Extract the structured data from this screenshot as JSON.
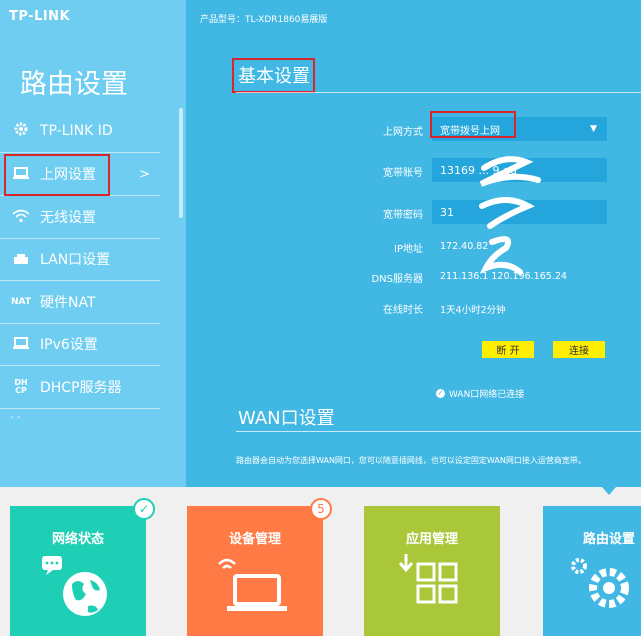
{
  "header": {
    "logo": "TP-LINK",
    "product_model": "产品型号：TL-XDR1860易展版"
  },
  "sidebar": {
    "title": "路由设置",
    "items": [
      {
        "label": "TP-LINK ID",
        "icon": "gear-icon"
      },
      {
        "label": "上网设置",
        "icon": "laptop-icon",
        "arrow": ">"
      },
      {
        "label": "无线设置",
        "icon": "wifi-icon"
      },
      {
        "label": "LAN口设置",
        "icon": "lan-icon"
      },
      {
        "label": "硬件NAT",
        "icon": "nat-icon",
        "icon_text": "NAT"
      },
      {
        "label": "IPv6设置",
        "icon": "laptop-icon"
      },
      {
        "label": "DHCP服务器",
        "icon": "dhcp-icon",
        "icon_text": "DH CP"
      }
    ],
    "more": "- -"
  },
  "basic": {
    "title": "基本设置",
    "connection_type_label": "上网方式",
    "connection_type_value": "宽带拨号上网",
    "account_label": "宽带账号",
    "account_value": "13169 ... 9.gd",
    "password_label": "宽带密码",
    "password_value": "31",
    "ip_label": "IP地址",
    "ip_value": "172.40.82",
    "dns_label": "DNS服务器",
    "dns_value": "211.136.1  120.196.165.24",
    "uptime_label": "在线时长",
    "uptime_value": "1天4小时2分钟",
    "disconnect_button": "断 开",
    "connect_button": "连接",
    "status_text": "WAN口网络已连接"
  },
  "wan": {
    "title": "WAN口设置",
    "description": "路由器会自动为您选择WAN网口，您可以随意插网线，也可以设定固定WAN网口接入运营商宽带。"
  },
  "tiles": [
    {
      "label": "网络状态",
      "color": "#1fcfb5",
      "icon": "globe-icon",
      "badge": "✓"
    },
    {
      "label": "设备管理",
      "color": "#ff7a45",
      "icon": "laptop-wifi-icon",
      "badge": "5"
    },
    {
      "label": "应用管理",
      "color": "#a9c739",
      "icon": "apps-grid-icon"
    },
    {
      "label": "路由设置",
      "color": "#41b8e4",
      "icon": "gear-icon"
    }
  ],
  "colors": {
    "accent": "#41b8e4",
    "sidebar": "#6ecdf0",
    "highlight": "#d9252c",
    "button": "#ffee00"
  }
}
